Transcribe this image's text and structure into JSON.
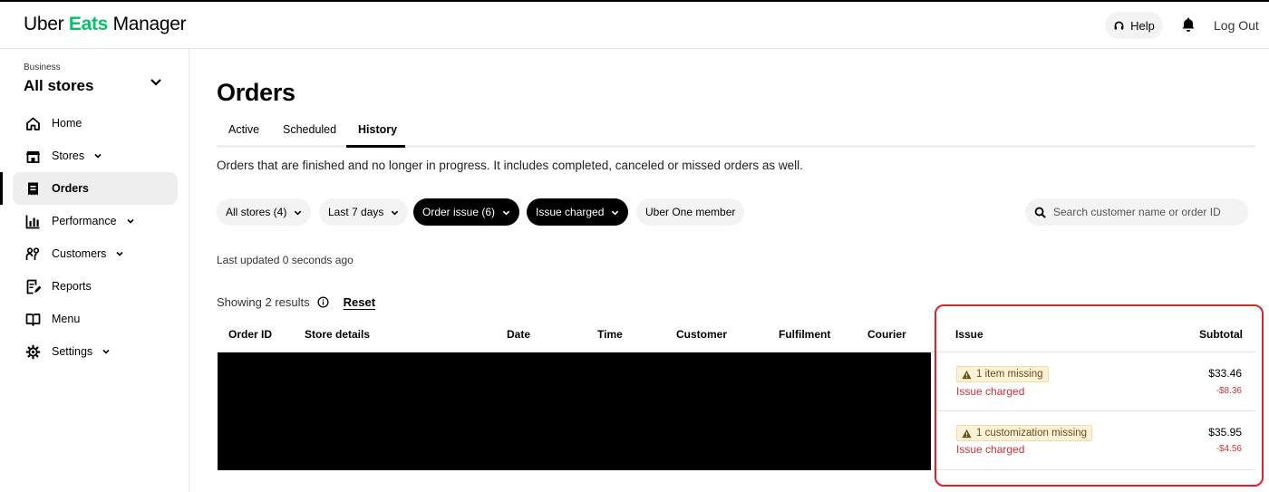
{
  "app": {
    "logo": {
      "part1": "Uber",
      "part2": "Eats",
      "part3": "Manager"
    },
    "help_label": "Help",
    "logout_label": "Log Out",
    "accent_color": "#06c167"
  },
  "sidebar": {
    "business_label": "Business",
    "business_name": "All stores",
    "items": [
      {
        "label": "Home",
        "icon": "home-icon",
        "has_chevron": false
      },
      {
        "label": "Stores",
        "icon": "store-icon",
        "has_chevron": true
      },
      {
        "label": "Orders",
        "icon": "receipt-icon",
        "has_chevron": false,
        "active": true
      },
      {
        "label": "Performance",
        "icon": "bar-chart-icon",
        "has_chevron": true
      },
      {
        "label": "Customers",
        "icon": "people-icon",
        "has_chevron": true
      },
      {
        "label": "Reports",
        "icon": "report-icon",
        "has_chevron": false
      },
      {
        "label": "Menu",
        "icon": "book-icon",
        "has_chevron": false
      },
      {
        "label": "Settings",
        "icon": "gear-icon",
        "has_chevron": true
      }
    ]
  },
  "main": {
    "title": "Orders",
    "tabs": [
      {
        "label": "Active"
      },
      {
        "label": "Scheduled"
      },
      {
        "label": "History",
        "selected": true
      }
    ],
    "description": "Orders that are finished and no longer in progress. It includes completed, canceled or missed orders as well.",
    "filters": [
      {
        "label": "All stores (4)",
        "dark": false,
        "chevron": true
      },
      {
        "label": "Last 7 days",
        "dark": false,
        "chevron": true
      },
      {
        "label": "Order issue (6)",
        "dark": true,
        "chevron": true
      },
      {
        "label": "Issue charged",
        "dark": true,
        "chevron": true
      },
      {
        "label": "Uber One member",
        "dark": false,
        "chevron": false
      }
    ],
    "search_placeholder": "Search customer name or order ID",
    "last_updated": "Last updated 0 seconds ago",
    "showing": "Showing 2 results",
    "reset_label": "Reset"
  },
  "table": {
    "columns": [
      "Order ID",
      "Store details",
      "Date",
      "Time",
      "Customer",
      "Fulfilment",
      "Courier",
      "Issue",
      "Subtotal"
    ],
    "rows": [
      {
        "issue_badge": "1 item missing",
        "issue_status": "Issue charged",
        "subtotal": "$33.46",
        "charge": "-$8.36"
      },
      {
        "issue_badge": "1 customization missing",
        "issue_status": "Issue charged",
        "subtotal": "$35.95",
        "charge": "-$4.56"
      }
    ],
    "issue_color": "#d4303a",
    "highlight_color": "#e0202a"
  }
}
